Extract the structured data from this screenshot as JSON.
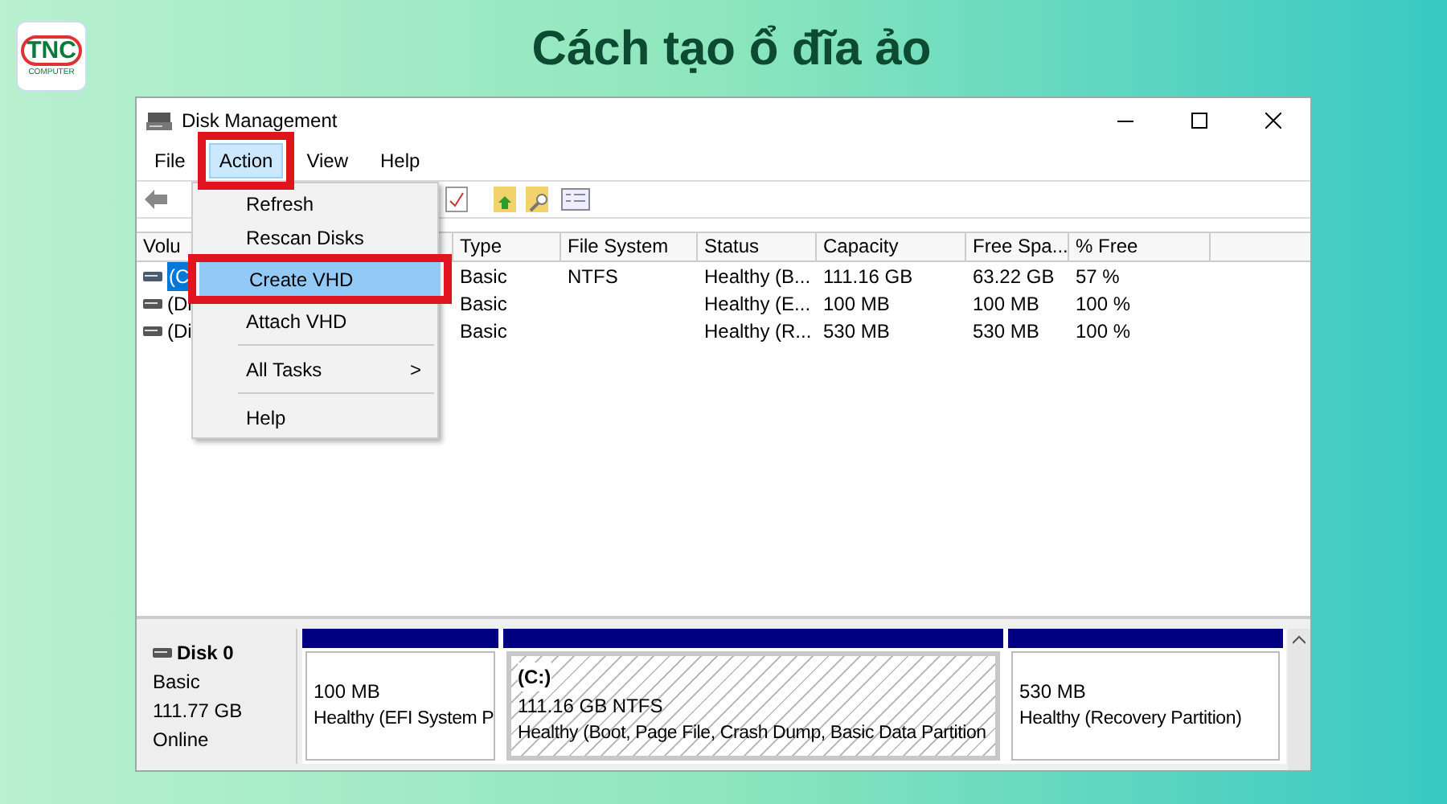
{
  "header": {
    "logo": {
      "mark": "TNC",
      "caption": "COMPUTER"
    },
    "title": "Cách tạo ổ đĩa ảo"
  },
  "window": {
    "title": "Disk Management"
  },
  "menu_bar": [
    {
      "label": "File",
      "selected": false
    },
    {
      "label": "Action",
      "selected": true
    },
    {
      "label": "View",
      "selected": false
    },
    {
      "label": "Help",
      "selected": false
    }
  ],
  "action_menu": [
    {
      "kind": "item",
      "label": "Refresh",
      "selected": false
    },
    {
      "kind": "item",
      "label": "Rescan Disks",
      "selected": false
    },
    {
      "kind": "item",
      "label": "Create VHD",
      "selected": true
    },
    {
      "kind": "item",
      "label": "Attach VHD",
      "selected": false
    },
    {
      "kind": "separator"
    },
    {
      "kind": "submenu",
      "label": "All Tasks",
      "arrow": ">",
      "selected": false
    },
    {
      "kind": "separator"
    },
    {
      "kind": "item",
      "label": "Help",
      "selected": false
    }
  ],
  "table": {
    "columns": [
      "Volu",
      "Type",
      "File System",
      "Status",
      "Capacity",
      "Free Spa...",
      "% Free"
    ],
    "rows": [
      {
        "selected": true,
        "cells": [
          "(C",
          "Basic",
          "NTFS",
          "Healthy (B...",
          "111.16 GB",
          "63.22 GB",
          "57 %"
        ]
      },
      {
        "selected": false,
        "cells": [
          "(Di",
          "Basic",
          "",
          "Healthy (E...",
          "100 MB",
          "100 MB",
          "100 %"
        ]
      },
      {
        "selected": false,
        "cells": [
          "(Di",
          "Basic",
          "",
          "Healthy (R...",
          "530 MB",
          "530 MB",
          "100 %"
        ]
      }
    ]
  },
  "disk": {
    "name": "Disk 0",
    "type": "Basic",
    "size": "111.77 GB",
    "status": "Online",
    "partitions": [
      {
        "selected": false,
        "size": "100 MB",
        "status": "Healthy (EFI System P"
      },
      {
        "selected": true,
        "label": "(C:)",
        "size": "111.16 GB NTFS",
        "status": "Healthy (Boot, Page File, Crash Dump, Basic Data Partition"
      },
      {
        "selected": false,
        "size": "530 MB",
        "status": "Healthy (Recovery Partition)"
      }
    ]
  }
}
